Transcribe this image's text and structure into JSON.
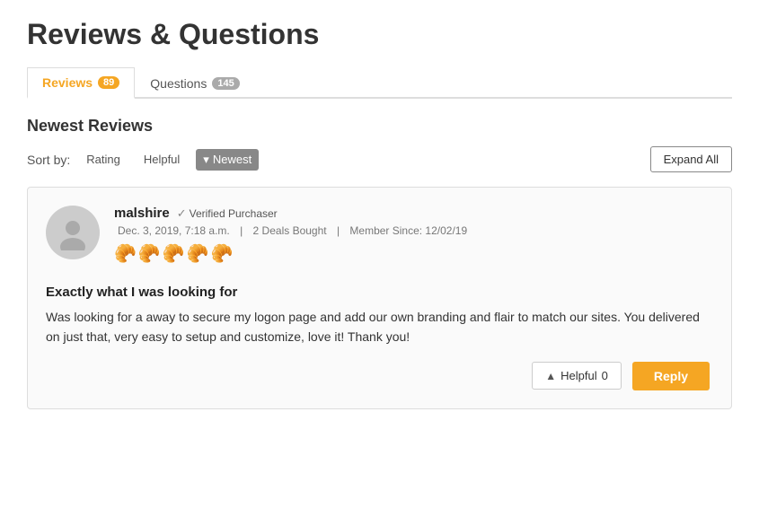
{
  "page": {
    "title": "Reviews & Questions"
  },
  "tabs": [
    {
      "id": "reviews",
      "label": "Reviews",
      "badge": "89",
      "active": true
    },
    {
      "id": "questions",
      "label": "Questions",
      "badge": "145",
      "active": false
    }
  ],
  "section": {
    "title": "Newest Reviews"
  },
  "sort": {
    "label": "Sort by:",
    "options": [
      {
        "id": "rating",
        "label": "Rating"
      },
      {
        "id": "helpful",
        "label": "Helpful"
      },
      {
        "id": "newest",
        "label": "Newest",
        "selected": true
      }
    ]
  },
  "expand_all_button": "Expand All",
  "review": {
    "avatar_icon": "👤",
    "username": "malshire",
    "verified_label": "Verified Purchaser",
    "date": "Dec. 3, 2019, 7:18 a.m.",
    "deals": "2 Deals Bought",
    "member_since": "Member Since: 12/02/19",
    "stars": [
      "🥐",
      "🥐",
      "🥐",
      "🥐",
      "🥐"
    ],
    "title": "Exactly what I was looking for",
    "body": "Was looking for a away to secure my logon page and add our own branding and flair to match our sites. You delivered on just that, very easy to setup and customize, love it! Thank you!",
    "helpful_label": "Helpful",
    "helpful_count": "0",
    "reply_label": "Reply"
  }
}
